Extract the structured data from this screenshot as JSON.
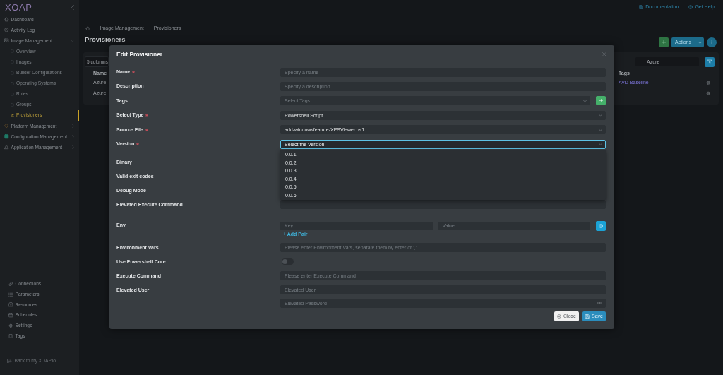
{
  "sidebar": {
    "logo": "XOAP",
    "items": [
      {
        "kind": "link",
        "label": "Dashboard",
        "selected": false
      },
      {
        "kind": "link",
        "label": "Activity Log",
        "selected": false
      },
      {
        "kind": "group",
        "label": "Image Management",
        "selected": false,
        "expanded": true,
        "children": [
          {
            "label": "Overview",
            "selected": false
          },
          {
            "label": "Images",
            "selected": false
          },
          {
            "label": "Builder Configurations",
            "selected": false
          },
          {
            "label": "Operating Systems",
            "selected": false
          },
          {
            "label": "Roles",
            "selected": false
          },
          {
            "label": "Groups",
            "selected": false
          },
          {
            "label": "Provisioners",
            "selected": true
          }
        ]
      },
      {
        "kind": "group",
        "label": "Platform Management",
        "selected": false,
        "expanded": false
      },
      {
        "kind": "group",
        "label": "Configuration Management",
        "selected": false,
        "expanded": false
      },
      {
        "kind": "group",
        "label": "Application Management",
        "selected": false,
        "expanded": false
      }
    ],
    "bottom_items": [
      {
        "label": "Connections",
        "selected": false
      },
      {
        "label": "Parameters",
        "selected": false
      },
      {
        "label": "Resources",
        "selected": false
      },
      {
        "label": "Schedules",
        "selected": false
      },
      {
        "label": "Settings",
        "selected": false
      },
      {
        "label": "Tags",
        "selected": false
      }
    ],
    "back_link": "Back to my.XOAP.io"
  },
  "top_links": [
    "Documentation",
    "Get Help"
  ],
  "breadcrumb": [
    "Image Management",
    "Provisioners"
  ],
  "page": {
    "title": "Provisioners",
    "actions_button": "Actions",
    "columns_select": "5 columns",
    "search_value": "Azure",
    "table": {
      "columns": [
        "Name",
        "Tags"
      ],
      "rows": [
        {
          "name": "Azure",
          "tags": [
            "AVD Baseline"
          ]
        },
        {
          "name": "Azure"
        }
      ]
    }
  },
  "modal": {
    "title": "Edit Provisioner",
    "fields": [
      {
        "kind": "input",
        "label": "Name",
        "required": true,
        "focused": false,
        "placeholder": "Specify a name"
      },
      {
        "kind": "input",
        "label": "Description",
        "required": false,
        "focused": false,
        "placeholder": "Specify a description"
      },
      {
        "kind": "select",
        "label": "Tags",
        "required": false,
        "focused": false,
        "expanded": false,
        "placeholder": "Select Tags",
        "add_button": true
      },
      {
        "kind": "select",
        "label": "Select Type",
        "required": true,
        "focused": false,
        "expanded": false,
        "value": "Powershell Script"
      },
      {
        "kind": "select",
        "label": "Source File",
        "required": true,
        "focused": false,
        "expanded": false,
        "value": "add-windowsfeature-XPSViewer.ps1"
      },
      {
        "kind": "select",
        "label": "Version",
        "required": true,
        "focused": true,
        "expanded": true,
        "value": "Select the Version",
        "options": [
          {
            "label": "0.0.1",
            "selected": false
          },
          {
            "label": "0.0.2",
            "selected": false
          },
          {
            "label": "0.0.3",
            "selected": false
          },
          {
            "label": "0.0.4",
            "selected": false
          },
          {
            "label": "0.0.5",
            "selected": false
          },
          {
            "label": "0.0.6",
            "selected": false
          }
        ]
      },
      {
        "kind": "covered",
        "label": "Binary",
        "required": false
      },
      {
        "kind": "covered",
        "label": "Valid exit codes",
        "required": false
      },
      {
        "kind": "covered",
        "label": "Debug Mode",
        "required": false
      },
      {
        "kind": "input",
        "label": "Elevated Execute Command",
        "required": false,
        "focused": false
      },
      {
        "kind": "pairs",
        "label": "Env",
        "required": false,
        "key_placeholder": "Key",
        "value_placeholder": "Value",
        "add_link": "+ Add Pair"
      },
      {
        "kind": "input",
        "label": "Environment Vars",
        "required": false,
        "focused": false,
        "placeholder": "Please enter Environment Vars, separate them by enter or ','"
      },
      {
        "kind": "toggle",
        "label": "Use Powershell Core",
        "required": false,
        "on": false
      },
      {
        "kind": "input",
        "label": "Execute Command",
        "required": false,
        "focused": false,
        "placeholder": "Please enter Execute Command"
      },
      {
        "kind": "input",
        "label": "Elevated User",
        "required": false,
        "focused": false,
        "placeholder": "Elevated User"
      },
      {
        "kind": "password",
        "required": false,
        "focused": false,
        "placeholder": "Elevated Password"
      }
    ],
    "buttons": [
      {
        "kind": "close",
        "label": "Close"
      },
      {
        "kind": "save",
        "label": "Save"
      }
    ]
  }
}
